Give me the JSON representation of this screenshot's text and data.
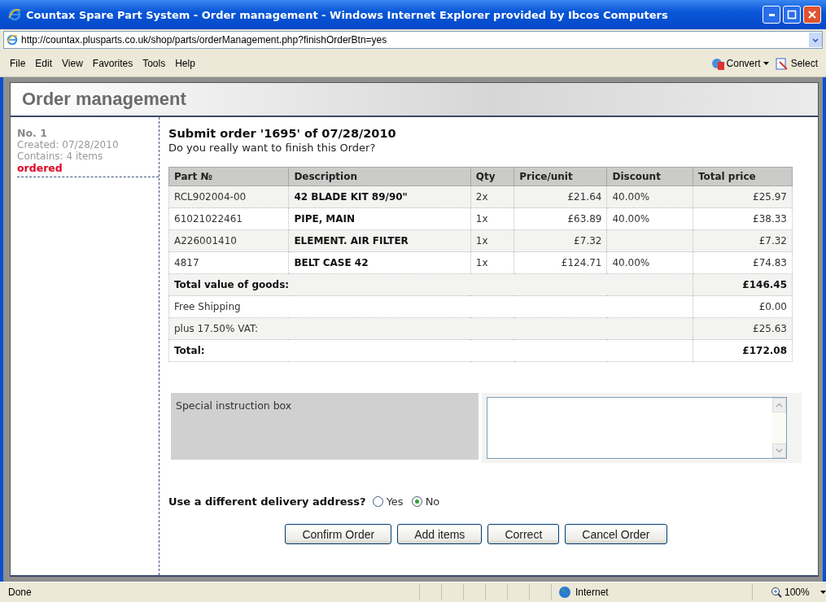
{
  "window": {
    "title": "Countax Spare Part System - Order management - Windows Internet Explorer provided by Ibcos Computers"
  },
  "address_bar": {
    "url": "http://countax.plusparts.co.uk/shop/parts/orderManagement.php?finishOrderBtn=yes"
  },
  "menu": [
    "File",
    "Edit",
    "View",
    "Favorites",
    "Tools",
    "Help"
  ],
  "toolbar": [
    "Convert",
    "Select"
  ],
  "page": {
    "heading": "Order management"
  },
  "sidebar": {
    "number": "No. 1",
    "created": "Created: 07/28/2010",
    "contains": "Contains: 4 items",
    "status": "ordered"
  },
  "order": {
    "title": "Submit order '1695' of 07/28/2010",
    "question": "Do you really want to finish this Order?",
    "columns": [
      "Part №",
      "Description",
      "Qty",
      "Price/unit",
      "Discount",
      "Total price"
    ],
    "rows": [
      {
        "part": "RCL902004-00",
        "description": "42 BLADE KIT 89/90\"",
        "qty": "2x",
        "price": "£21.64",
        "discount": "40.00%",
        "total": "£25.97"
      },
      {
        "part": "61021022461",
        "description": "PIPE, MAIN",
        "qty": "1x",
        "price": "£63.89",
        "discount": "40.00%",
        "total": "£38.33"
      },
      {
        "part": "A226001410",
        "description": "ELEMENT. AIR FILTER",
        "qty": "1x",
        "price": "£7.32",
        "total": "£7.32"
      },
      {
        "part": "4817",
        "description": "BELT CASE 42",
        "qty": "1x",
        "price": "£124.71",
        "discount": "40.00%",
        "total": "£74.83"
      }
    ],
    "summary": [
      {
        "kind": "total",
        "label": "Total value of goods:",
        "value": "£146.45"
      },
      {
        "kind": "line",
        "label": "Free Shipping",
        "value": "£0.00"
      },
      {
        "kind": "line",
        "label": "plus 17.50% VAT:",
        "value": "£25.63"
      },
      {
        "kind": "total",
        "label": "Total:",
        "value": "£172.08"
      }
    ]
  },
  "instructions": {
    "label": "Special instruction box"
  },
  "delivery": {
    "question": "Use a different delivery address?",
    "options": [
      {
        "label": "Yes",
        "selected": false
      },
      {
        "label": "No",
        "selected": true
      }
    ]
  },
  "buttons": [
    "Confirm Order",
    "Add items",
    "Correct",
    "Cancel Order"
  ],
  "status_bar": {
    "status": "Done",
    "zone": "Internet",
    "zoom": "100%"
  }
}
